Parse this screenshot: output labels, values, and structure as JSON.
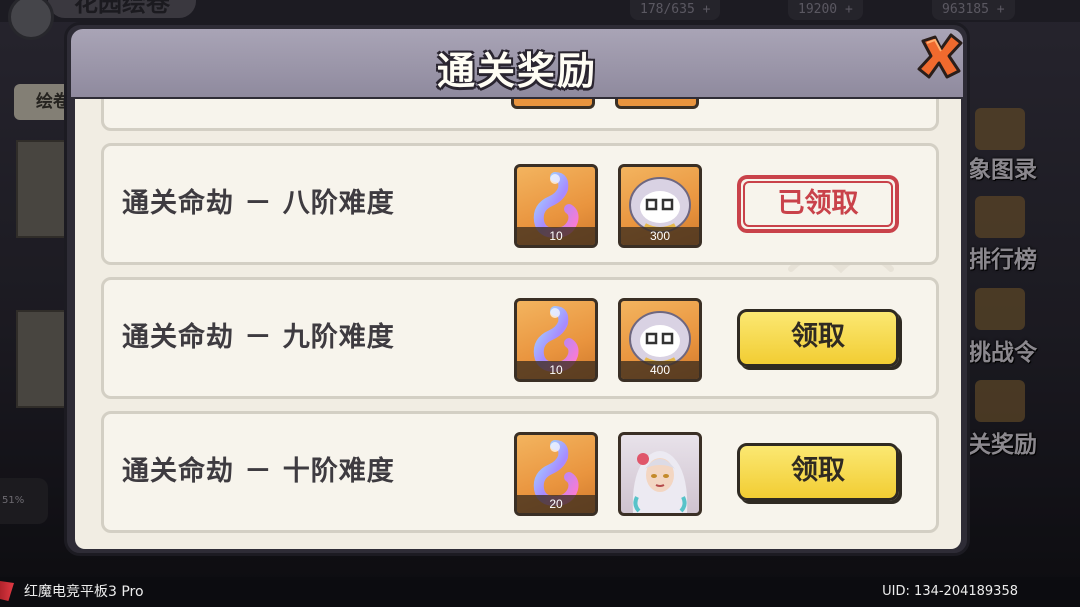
{
  "background": {
    "title": "花园绘卷",
    "resources": [
      "178/635 +",
      "19200 +",
      "963185 +"
    ],
    "left_tab": "绘卷",
    "left_percent": "51%",
    "side_menu": [
      "象图录",
      "排行榜",
      "挑战令",
      "关奖励"
    ]
  },
  "modal": {
    "title": "通关奖励",
    "close_icon": "close-x-icon",
    "rows": [
      {
        "label": "通关命劫 － 八阶难度",
        "rewards": [
          {
            "icon": "crystal-gourd-icon",
            "count": "10"
          },
          {
            "icon": "silver-coin-spirit-icon",
            "count": "300"
          }
        ],
        "button": "已领取",
        "state": "claimed"
      },
      {
        "label": "通关命劫 － 九阶难度",
        "rewards": [
          {
            "icon": "crystal-gourd-icon",
            "count": "10"
          },
          {
            "icon": "silver-coin-spirit-icon",
            "count": "400"
          }
        ],
        "button": "领取",
        "state": "claimable"
      },
      {
        "label": "通关命劫 － 十阶难度",
        "rewards": [
          {
            "icon": "crystal-gourd-icon",
            "count": "20"
          },
          {
            "icon": "character-portrait-icon",
            "count": ""
          }
        ],
        "button": "领取",
        "state": "claimable"
      }
    ]
  },
  "system_bar": {
    "device": "红魔电竞平板3 Pro",
    "uid": "UID: 134-204189358"
  },
  "colors": {
    "claim_button": "#f2cd33",
    "claimed_stamp": "#c9424a",
    "header": "#9e99ad",
    "panel": "#f1ede3"
  }
}
